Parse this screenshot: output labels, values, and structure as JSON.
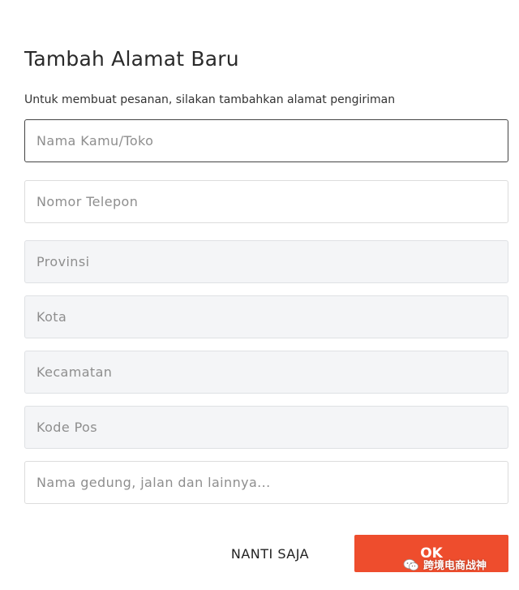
{
  "dialog": {
    "title": "Tambah Alamat Baru",
    "subtitle": "Untuk membuat pesanan, silakan tambahkan alamat pengiriman"
  },
  "fields": {
    "name_placeholder": "Nama Kamu/Toko",
    "phone_placeholder": "Nomor Telepon",
    "province_placeholder": "Provinsi",
    "city_placeholder": "Kota",
    "district_placeholder": "Kecamatan",
    "postal_placeholder": "Kode Pos",
    "address_placeholder": "Nama gedung, jalan dan lainnya..."
  },
  "actions": {
    "later_label": "NANTI SAJA",
    "ok_label": "OK"
  },
  "watermark": {
    "text": "跨境电商战神",
    "icon": "wechat-icon"
  },
  "colors": {
    "accent": "#ee4d2d",
    "select_field_bg": "#f4f5f7",
    "focused_border": "#444444"
  }
}
